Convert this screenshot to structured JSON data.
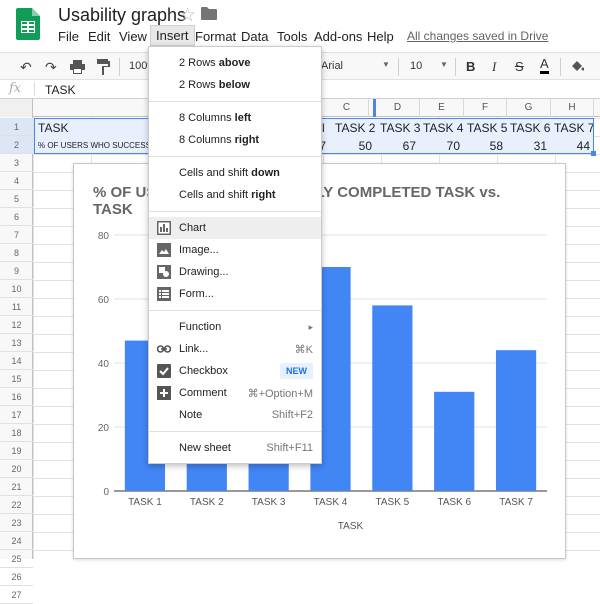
{
  "doc": {
    "title": "Usability graphs",
    "saved_status": "All changes saved in Drive"
  },
  "menubar": [
    "File",
    "Edit",
    "View",
    "Insert",
    "Format",
    "Data",
    "Tools",
    "Add-ons",
    "Help"
  ],
  "toolbar": {
    "zoom": "100%",
    "font": "Arial",
    "font_size": "10",
    "bold": "B",
    "italic": "I",
    "strike": "S",
    "text_color": "A"
  },
  "formula_bar": {
    "fx": "fx",
    "value": "TASK"
  },
  "columns": [
    "C",
    "D",
    "E",
    "F",
    "G",
    "H"
  ],
  "rows": [
    "1",
    "2",
    "3",
    "4",
    "5",
    "6",
    "7",
    "8",
    "9",
    "10",
    "11",
    "12",
    "13",
    "14",
    "15",
    "16",
    "17",
    "18",
    "19",
    "20",
    "21",
    "22",
    "23",
    "24",
    "25",
    "26",
    "27"
  ],
  "sheet": {
    "a1": "TASK",
    "a2": "% OF USERS WHO SUCCESSFULLY COMPLETED TASK",
    "b2_partial": "7",
    "b1_partial": "l",
    "row1": [
      "TASK 2",
      "TASK 3",
      "TASK 4",
      "TASK 5",
      "TASK 6",
      "TASK 7"
    ],
    "row2": [
      "50",
      "67",
      "70",
      "58",
      "31",
      "44"
    ]
  },
  "insert_menu": {
    "rows_above_prefix": "2 Rows ",
    "rows_above_bold": "above",
    "rows_below_prefix": "2 Rows ",
    "rows_below_bold": "below",
    "cols_left_prefix": "8 Columns ",
    "cols_left_bold": "left",
    "cols_right_prefix": "8 Columns ",
    "cols_right_bold": "right",
    "shift_down_prefix": "Cells and shift ",
    "shift_down_bold": "down",
    "shift_right_prefix": "Cells and shift ",
    "shift_right_bold": "right",
    "chart": "Chart",
    "image": "Image...",
    "drawing": "Drawing...",
    "form": "Form...",
    "function": "Function",
    "function_arrow": "▸",
    "link": "Link...",
    "link_shortcut": "⌘K",
    "checkbox": "Checkbox",
    "checkbox_badge": "NEW",
    "comment": "Comment",
    "comment_shortcut": "⌘+Option+M",
    "note": "Note",
    "note_shortcut": "Shift+F2",
    "new_sheet": "New sheet",
    "new_sheet_shortcut": "Shift+F11"
  },
  "colors": {
    "accent": "#4285f4",
    "bar": "#4285f4",
    "selection": "#4a86e8"
  },
  "chart_data": {
    "type": "bar",
    "title_left": "% OF US",
    "title_right": "LLY COMPLETED TASK vs.",
    "title_line2": "TASK",
    "categories": [
      "TASK 1",
      "TASK 2",
      "TASK 3",
      "TASK 4",
      "TASK 5",
      "TASK 6",
      "TASK 7"
    ],
    "values": [
      47,
      50,
      67,
      70,
      58,
      31,
      44
    ],
    "xlabel": "TASK",
    "ylabel": "",
    "ylim": [
      0,
      80
    ],
    "yticks": [
      "0",
      "20",
      "40",
      "60",
      "80"
    ],
    "grid": true,
    "color": "#4285f4"
  }
}
